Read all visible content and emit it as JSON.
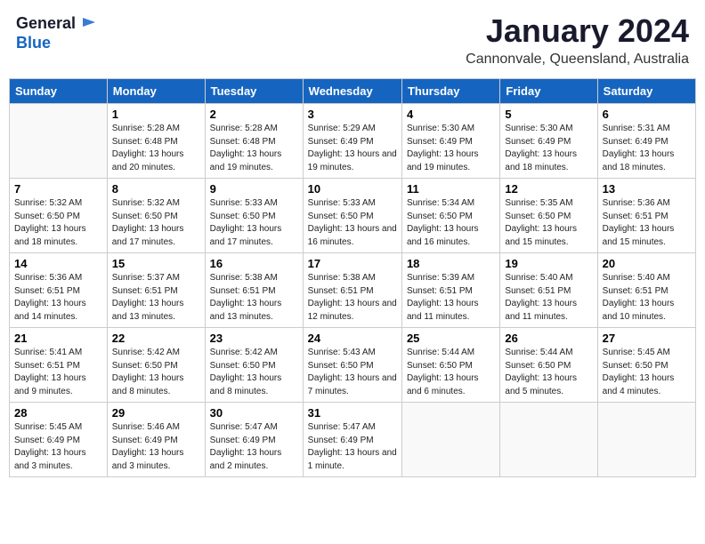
{
  "header": {
    "logo_line1": "General",
    "logo_line2": "Blue",
    "month_title": "January 2024",
    "subtitle": "Cannonvale, Queensland, Australia"
  },
  "weekdays": [
    "Sunday",
    "Monday",
    "Tuesday",
    "Wednesday",
    "Thursday",
    "Friday",
    "Saturday"
  ],
  "weeks": [
    [
      {
        "day": "",
        "info": ""
      },
      {
        "day": "1",
        "info": "Sunrise: 5:28 AM\nSunset: 6:48 PM\nDaylight: 13 hours\nand 20 minutes."
      },
      {
        "day": "2",
        "info": "Sunrise: 5:28 AM\nSunset: 6:48 PM\nDaylight: 13 hours\nand 19 minutes."
      },
      {
        "day": "3",
        "info": "Sunrise: 5:29 AM\nSunset: 6:49 PM\nDaylight: 13 hours\nand 19 minutes."
      },
      {
        "day": "4",
        "info": "Sunrise: 5:30 AM\nSunset: 6:49 PM\nDaylight: 13 hours\nand 19 minutes."
      },
      {
        "day": "5",
        "info": "Sunrise: 5:30 AM\nSunset: 6:49 PM\nDaylight: 13 hours\nand 18 minutes."
      },
      {
        "day": "6",
        "info": "Sunrise: 5:31 AM\nSunset: 6:49 PM\nDaylight: 13 hours\nand 18 minutes."
      }
    ],
    [
      {
        "day": "7",
        "info": "Sunrise: 5:32 AM\nSunset: 6:50 PM\nDaylight: 13 hours\nand 18 minutes."
      },
      {
        "day": "8",
        "info": "Sunrise: 5:32 AM\nSunset: 6:50 PM\nDaylight: 13 hours\nand 17 minutes."
      },
      {
        "day": "9",
        "info": "Sunrise: 5:33 AM\nSunset: 6:50 PM\nDaylight: 13 hours\nand 17 minutes."
      },
      {
        "day": "10",
        "info": "Sunrise: 5:33 AM\nSunset: 6:50 PM\nDaylight: 13 hours\nand 16 minutes."
      },
      {
        "day": "11",
        "info": "Sunrise: 5:34 AM\nSunset: 6:50 PM\nDaylight: 13 hours\nand 16 minutes."
      },
      {
        "day": "12",
        "info": "Sunrise: 5:35 AM\nSunset: 6:50 PM\nDaylight: 13 hours\nand 15 minutes."
      },
      {
        "day": "13",
        "info": "Sunrise: 5:36 AM\nSunset: 6:51 PM\nDaylight: 13 hours\nand 15 minutes."
      }
    ],
    [
      {
        "day": "14",
        "info": "Sunrise: 5:36 AM\nSunset: 6:51 PM\nDaylight: 13 hours\nand 14 minutes."
      },
      {
        "day": "15",
        "info": "Sunrise: 5:37 AM\nSunset: 6:51 PM\nDaylight: 13 hours\nand 13 minutes."
      },
      {
        "day": "16",
        "info": "Sunrise: 5:38 AM\nSunset: 6:51 PM\nDaylight: 13 hours\nand 13 minutes."
      },
      {
        "day": "17",
        "info": "Sunrise: 5:38 AM\nSunset: 6:51 PM\nDaylight: 13 hours\nand 12 minutes."
      },
      {
        "day": "18",
        "info": "Sunrise: 5:39 AM\nSunset: 6:51 PM\nDaylight: 13 hours\nand 11 minutes."
      },
      {
        "day": "19",
        "info": "Sunrise: 5:40 AM\nSunset: 6:51 PM\nDaylight: 13 hours\nand 11 minutes."
      },
      {
        "day": "20",
        "info": "Sunrise: 5:40 AM\nSunset: 6:51 PM\nDaylight: 13 hours\nand 10 minutes."
      }
    ],
    [
      {
        "day": "21",
        "info": "Sunrise: 5:41 AM\nSunset: 6:51 PM\nDaylight: 13 hours\nand 9 minutes."
      },
      {
        "day": "22",
        "info": "Sunrise: 5:42 AM\nSunset: 6:50 PM\nDaylight: 13 hours\nand 8 minutes."
      },
      {
        "day": "23",
        "info": "Sunrise: 5:42 AM\nSunset: 6:50 PM\nDaylight: 13 hours\nand 8 minutes."
      },
      {
        "day": "24",
        "info": "Sunrise: 5:43 AM\nSunset: 6:50 PM\nDaylight: 13 hours\nand 7 minutes."
      },
      {
        "day": "25",
        "info": "Sunrise: 5:44 AM\nSunset: 6:50 PM\nDaylight: 13 hours\nand 6 minutes."
      },
      {
        "day": "26",
        "info": "Sunrise: 5:44 AM\nSunset: 6:50 PM\nDaylight: 13 hours\nand 5 minutes."
      },
      {
        "day": "27",
        "info": "Sunrise: 5:45 AM\nSunset: 6:50 PM\nDaylight: 13 hours\nand 4 minutes."
      }
    ],
    [
      {
        "day": "28",
        "info": "Sunrise: 5:45 AM\nSunset: 6:49 PM\nDaylight: 13 hours\nand 3 minutes."
      },
      {
        "day": "29",
        "info": "Sunrise: 5:46 AM\nSunset: 6:49 PM\nDaylight: 13 hours\nand 3 minutes."
      },
      {
        "day": "30",
        "info": "Sunrise: 5:47 AM\nSunset: 6:49 PM\nDaylight: 13 hours\nand 2 minutes."
      },
      {
        "day": "31",
        "info": "Sunrise: 5:47 AM\nSunset: 6:49 PM\nDaylight: 13 hours\nand 1 minute."
      },
      {
        "day": "",
        "info": ""
      },
      {
        "day": "",
        "info": ""
      },
      {
        "day": "",
        "info": ""
      }
    ]
  ]
}
